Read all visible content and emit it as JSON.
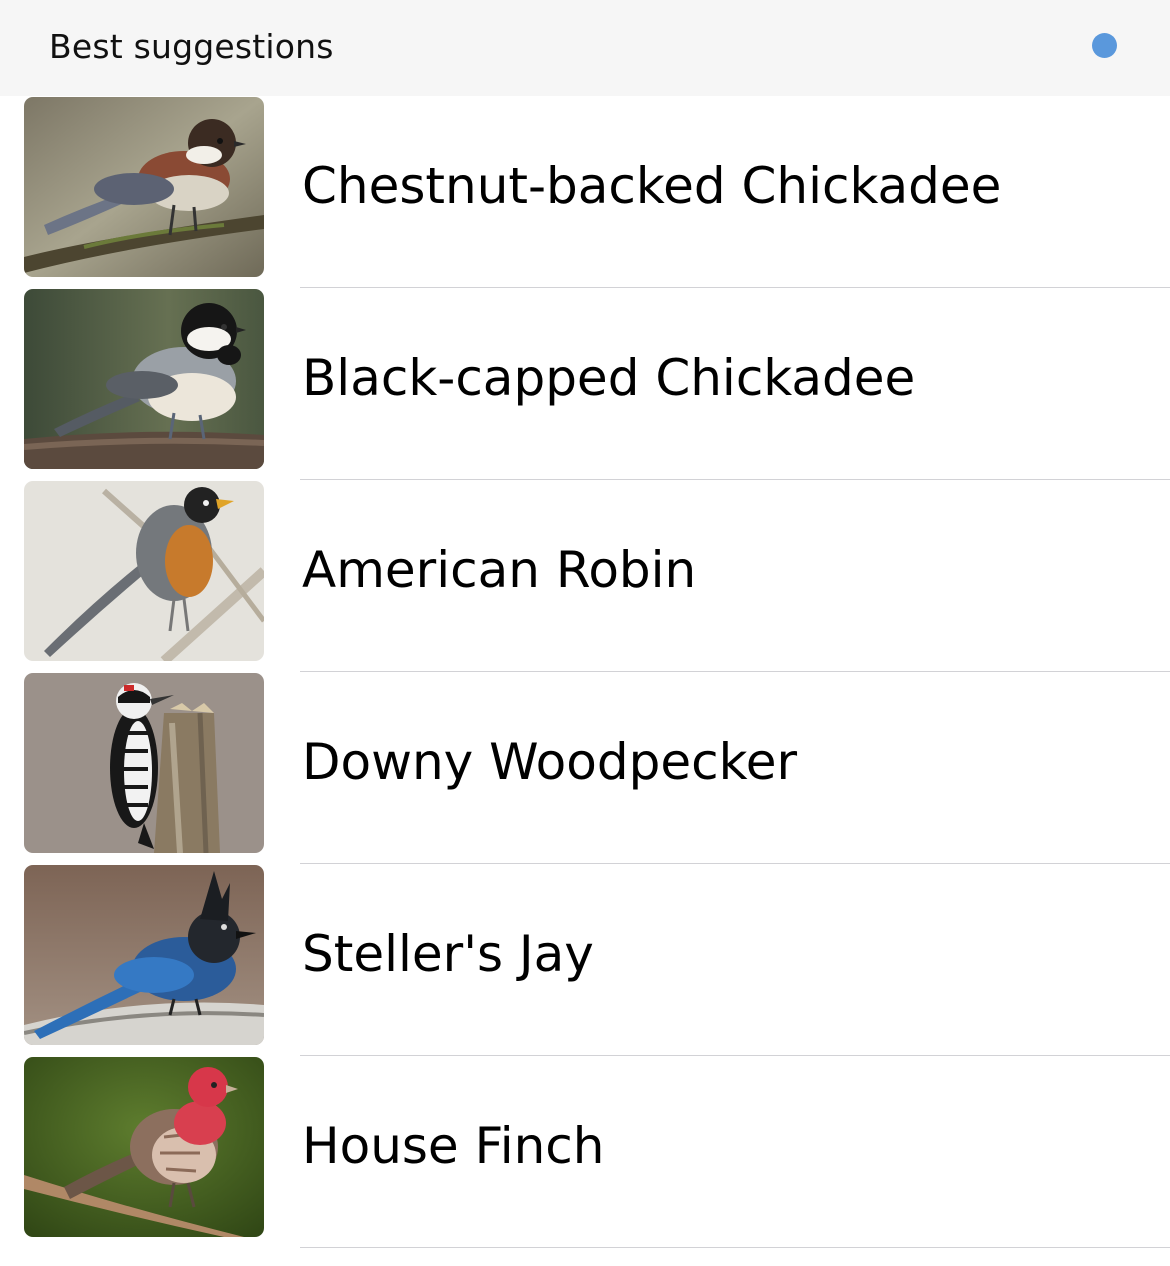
{
  "header": {
    "title": "Best suggestions",
    "status_dot_color": "#5a98dc"
  },
  "suggestions": [
    {
      "label": "Chestnut-backed Chickadee",
      "image": "chestnut-backed-chickadee-photo"
    },
    {
      "label": "Black-capped Chickadee",
      "image": "black-capped-chickadee-photo"
    },
    {
      "label": "American Robin",
      "image": "american-robin-photo"
    },
    {
      "label": "Downy Woodpecker",
      "image": "downy-woodpecker-photo"
    },
    {
      "label": "Steller's Jay",
      "image": "stellers-jay-photo"
    },
    {
      "label": "House Finch",
      "image": "house-finch-photo"
    }
  ]
}
